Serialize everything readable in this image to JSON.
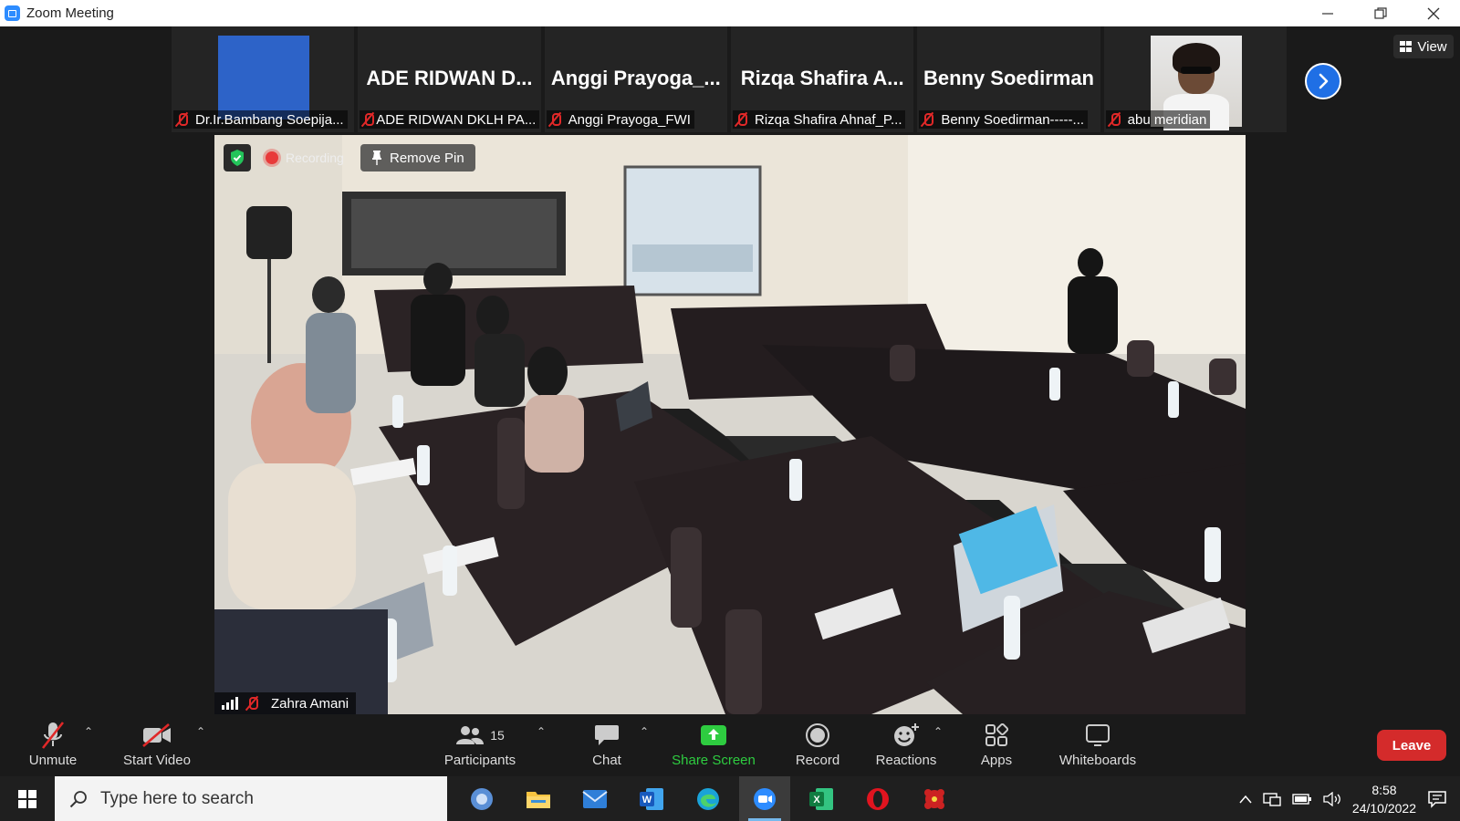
{
  "window": {
    "title": "Zoom Meeting",
    "controls": [
      "minimize",
      "restore",
      "close"
    ]
  },
  "participants_strip": [
    {
      "display_name": "",
      "label": "Dr.Ir.Bambang Soepija...",
      "tile": "blue-video"
    },
    {
      "display_name": "ADE RIDWAN D...",
      "label": "ADE RIDWAN DKLH PA...",
      "tile": "name"
    },
    {
      "display_name": "Anggi Prayoga_...",
      "label": "Anggi Prayoga_FWI",
      "tile": "name"
    },
    {
      "display_name": "Rizqa Shafira A...",
      "label": "Rizqa Shafira Ahnaf_P...",
      "tile": "name"
    },
    {
      "display_name": "Benny Soedirman",
      "label": "Benny Soedirman-----...",
      "tile": "name"
    },
    {
      "display_name": "",
      "label": "abu meridian",
      "tile": "face-video"
    }
  ],
  "view_button": {
    "label": "View"
  },
  "main_video": {
    "recording_label": "Recording",
    "remove_pin_label": "Remove Pin",
    "speaker_label": "Zahra Amani"
  },
  "toolbar": {
    "unmute": "Unmute",
    "start_video": "Start Video",
    "participants": "Participants",
    "participants_count": "15",
    "chat": "Chat",
    "share_screen": "Share Screen",
    "record": "Record",
    "reactions": "Reactions",
    "apps": "Apps",
    "whiteboards": "Whiteboards",
    "leave": "Leave"
  },
  "colors": {
    "accent_blue": "#2d8cff",
    "share_green": "#2ecc40",
    "leave_red": "#d42b2b",
    "mic_off_red": "#e02828"
  },
  "taskbar": {
    "search_placeholder": "Type here to search",
    "time": "8:58",
    "date": "24/10/2022",
    "apps": [
      "outlook-icon",
      "file-explorer-icon",
      "mail-icon",
      "word-icon",
      "edge-icon",
      "zoom-icon",
      "excel-icon",
      "opera-icon",
      "game-icon"
    ]
  }
}
